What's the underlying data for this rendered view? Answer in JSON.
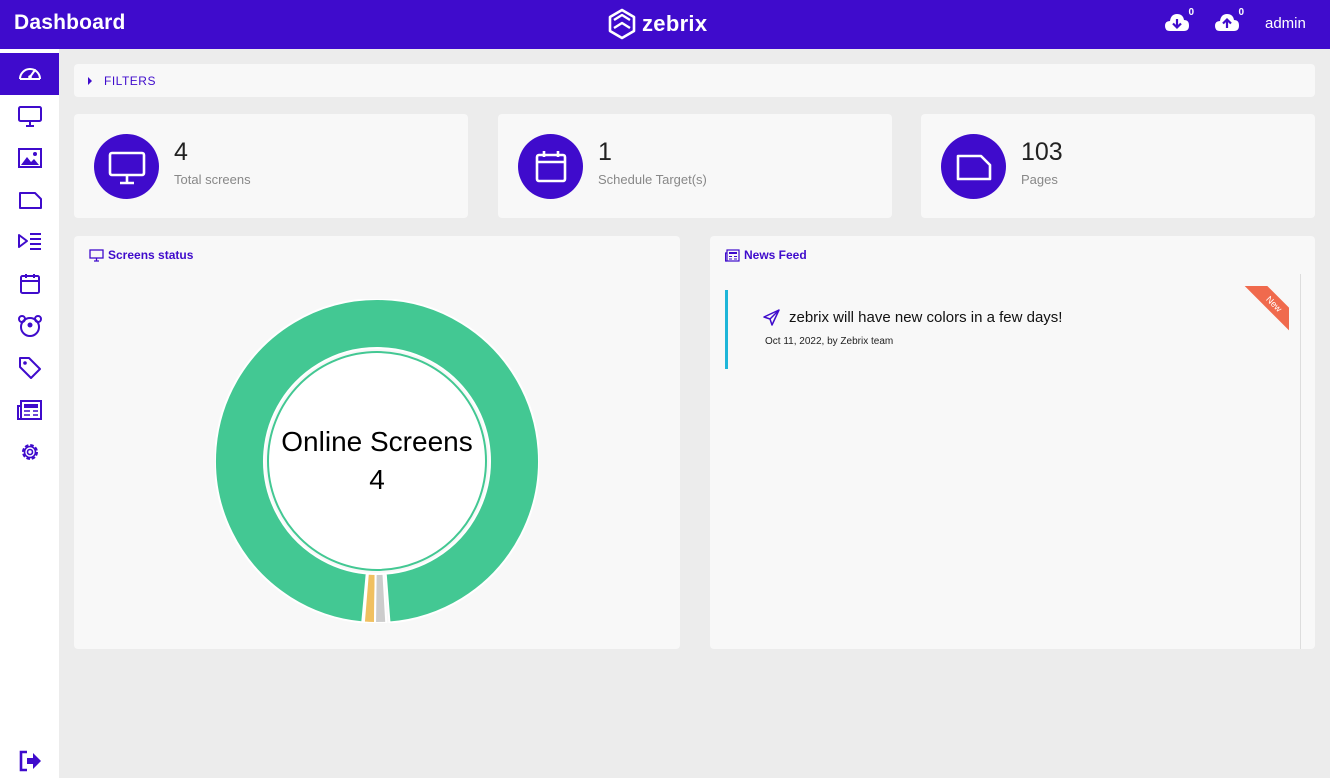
{
  "header": {
    "title": "Dashboard",
    "brand": "zebrix",
    "download_count": "0",
    "upload_count": "0",
    "user": "admin"
  },
  "sidebar": {
    "items": [
      {
        "icon": "dashboard-gauge-icon",
        "active": true
      },
      {
        "icon": "monitor-icon",
        "active": false
      },
      {
        "icon": "image-icon",
        "active": false
      },
      {
        "icon": "page-icon",
        "active": false
      },
      {
        "icon": "playlist-icon",
        "active": false
      },
      {
        "icon": "calendar-icon",
        "active": false
      },
      {
        "icon": "groups-icon",
        "active": false
      },
      {
        "icon": "tag-icon",
        "active": false
      },
      {
        "icon": "newspaper-icon",
        "active": false
      },
      {
        "icon": "gear-icon",
        "active": false
      }
    ],
    "logout_icon": "logout-icon"
  },
  "filters": {
    "label": "FILTERS"
  },
  "stats": [
    {
      "value": "4",
      "label": "Total screens",
      "icon": "monitor-icon"
    },
    {
      "value": "1",
      "label": "Schedule Target(s)",
      "icon": "calendar-icon"
    },
    {
      "value": "103",
      "label": "Pages",
      "icon": "page-icon"
    }
  ],
  "screens_status": {
    "title": "Screens status",
    "center_label": "Online Screens",
    "center_value": "4"
  },
  "chart_data": {
    "type": "pie",
    "title": "",
    "categories": [
      "online",
      "status-2",
      "status-3"
    ],
    "values": [
      97.8,
      1.1,
      1.1
    ],
    "colors": [
      "#43c893",
      "#f0c060",
      "#cccccc"
    ],
    "legend": "none"
  },
  "news_feed": {
    "title": "News Feed",
    "items": [
      {
        "title": "zebrix will have new colors in a few days!",
        "meta": "Oct 11, 2022, by Zebrix team",
        "badge": "New"
      }
    ]
  },
  "colors": {
    "brand": "#3f0bcc",
    "online": "#43c893",
    "news_accent": "#1fb6d9",
    "badge": "#f06a4d"
  }
}
